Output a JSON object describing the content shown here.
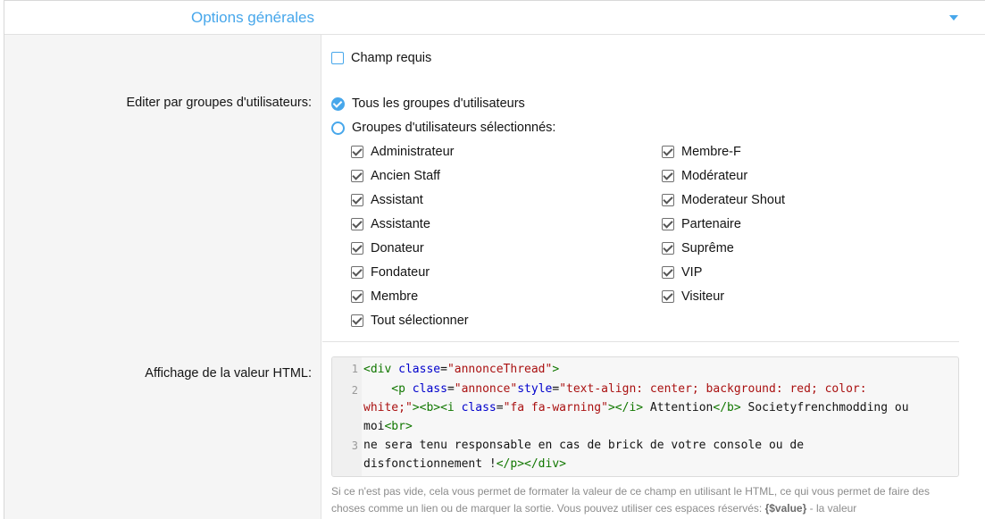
{
  "section": {
    "title": "Options générales",
    "collapse_icon": "caret-down-icon",
    "accent_color": "#47a7eb"
  },
  "required": {
    "label": "Champ requis",
    "checked": false
  },
  "edit_groups": {
    "label": "Editer par groupes d'utilisateurs:",
    "all_option": "Tous les groupes d'utilisateurs",
    "selected_option": "Groupes d'utilisateurs sélectionnés:",
    "current": "all",
    "left_groups": [
      "Administrateur",
      "Ancien Staff",
      "Assistant",
      "Assistante",
      "Donateur",
      "Fondateur",
      "Membre",
      "Tout sélectionner"
    ],
    "right_groups": [
      "Membre-F",
      "Modérateur",
      "Moderateur Shout",
      "Partenaire",
      "Suprême",
      "VIP",
      "Visiteur"
    ]
  },
  "html_display": {
    "label": "Affichage de la valeur HTML:",
    "line_numbers": [
      "1",
      "2",
      "3"
    ],
    "code": {
      "l1_t1": "<div ",
      "l1_a1": "classe",
      "l1_t2": "=",
      "l1_s1": "\"annonceThread\"",
      "l1_t3": ">",
      "l2_t1": "    <p ",
      "l2_a1": "class",
      "l2_t2": "=",
      "l2_s1": "\"annonce\"",
      "l2_a2": "style",
      "l2_t3": "=",
      "l2_s2": "\"text-align: center; background: red; color:",
      "l2b_s1": "white;\"",
      "l2b_t1": "><b><i ",
      "l2b_a1": "class",
      "l2b_t2": "=",
      "l2b_s2": "\"fa fa-warning\"",
      "l2b_t3": "></i>",
      "l2b_p1": " Attention",
      "l2b_t4": "</b>",
      "l2b_p2": " Societyfrenchmodding ou",
      "l2c_p1": "moi",
      "l2c_t1": "<br>",
      "l3_p1": "ne sera tenu responsable en cas de brick de votre console ou de",
      "l3b_p1": "disfonctionnement !",
      "l3b_t1": "</p></div>"
    },
    "hint_text": "Si ce n'est pas vide, cela vous permet de formater la valeur de ce champ en utilisant le HTML, ce qui vous permet de faire des choses comme un lien ou de marquer la sortie. Vous pouvez utiliser ces espaces réservés: ",
    "hint_placeholder": "{$value}",
    "hint_tail": " - la valeur"
  }
}
